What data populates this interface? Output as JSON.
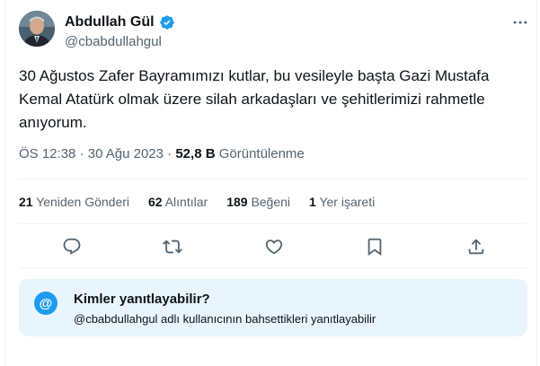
{
  "author": {
    "name": "Abdullah Gül",
    "handle": "@cbabdullahgul",
    "avatar_icon": "profile-photo",
    "verified_icon": "verified-badge-icon",
    "verified_color": "#1d9bf0"
  },
  "tweet": {
    "text": "30 Ağustos Zafer Bayramımızı kutlar, bu vesileyle başta Gazi Mustafa Kemal Atatürk olmak üzere silah arkadaşları ve şehitlerimizi rahmetle anıyorum.",
    "time": "ÖS 12:38",
    "date": "30 Ağu 2023",
    "separator": "·",
    "views_count": "52,8 B",
    "views_label": "Görüntülenme"
  },
  "stats": {
    "retweets_count": "21",
    "retweets_label": "Yeniden Gönderi",
    "quotes_count": "62",
    "quotes_label": "Alıntılar",
    "likes_count": "189",
    "likes_label": "Beğeni",
    "bookmarks_count": "1",
    "bookmarks_label": "Yer işareti"
  },
  "actions": {
    "icons": [
      "reply-icon",
      "retweet-icon",
      "like-icon",
      "bookmark-icon",
      "share-icon"
    ],
    "icon_color": "#536471"
  },
  "reply_restriction": {
    "icon": "at-sign",
    "icon_glyph": "@",
    "title": "Kimler yanıtlayabilir?",
    "subtitle": "@cbabdullahgul adlı kullanıcının bahsettikleri yanıtlayabilir",
    "background": "#e8f5fd"
  },
  "menu": {
    "more_icon": "more-options-icon"
  }
}
